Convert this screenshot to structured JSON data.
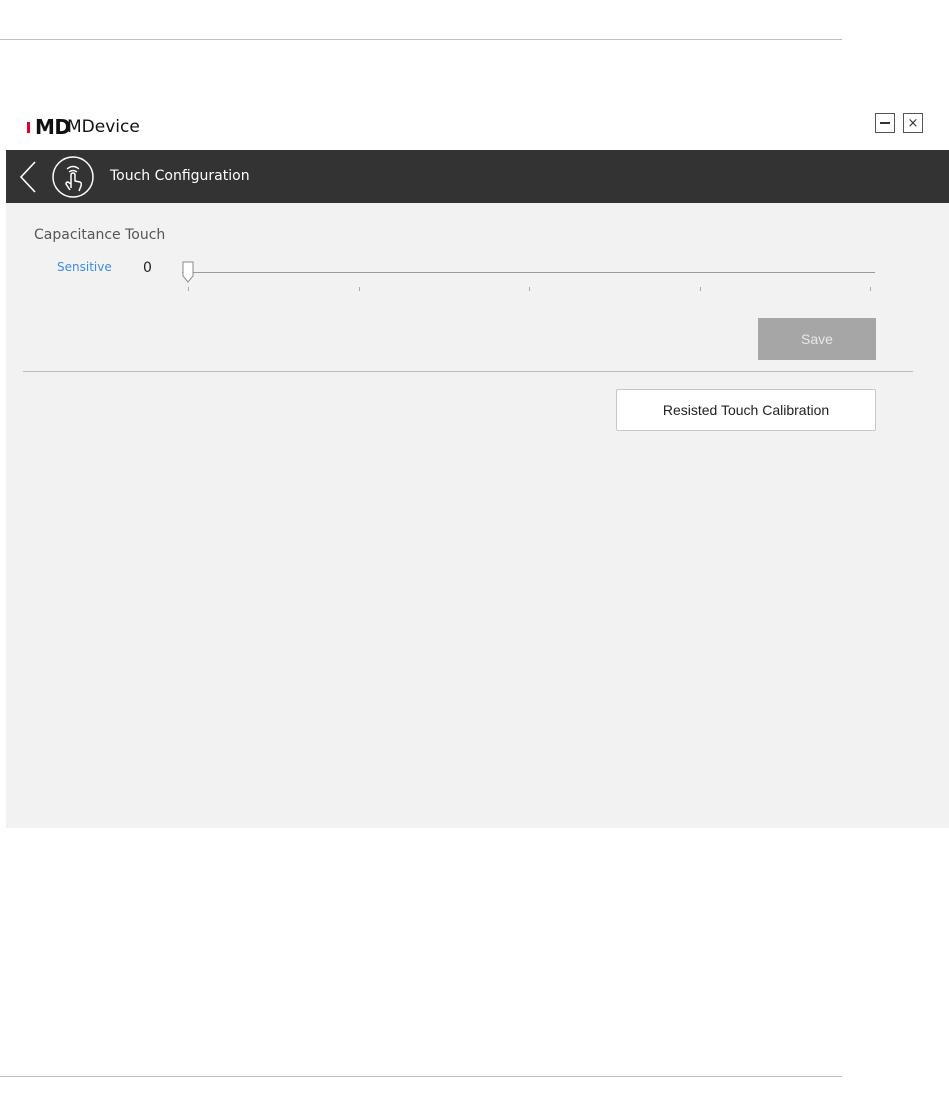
{
  "app": {
    "logo_text": "MD",
    "name": "MDevice"
  },
  "window_controls": {
    "minimize_icon": "minimize-icon",
    "close_icon": "close-icon",
    "close_glyph": "×"
  },
  "header": {
    "back_icon": "chevron-left-icon",
    "section_icon": "touch-hand-icon",
    "title": "Touch Configuration"
  },
  "capacitance": {
    "title": "Capacitance Touch",
    "sensitive_label": "Sensitive",
    "sensitive_value": "0",
    "slider": {
      "value": 0,
      "min": 0,
      "max": 4,
      "ticks": 5
    }
  },
  "buttons": {
    "save": "Save",
    "calibration": "Resisted Touch Calibration"
  },
  "colors": {
    "header_bg": "#333333",
    "content_bg": "#f2f2f2",
    "accent_blue": "#3a8ee6",
    "logo_red": "#e4002b",
    "save_disabled": "#a6a6a6"
  }
}
